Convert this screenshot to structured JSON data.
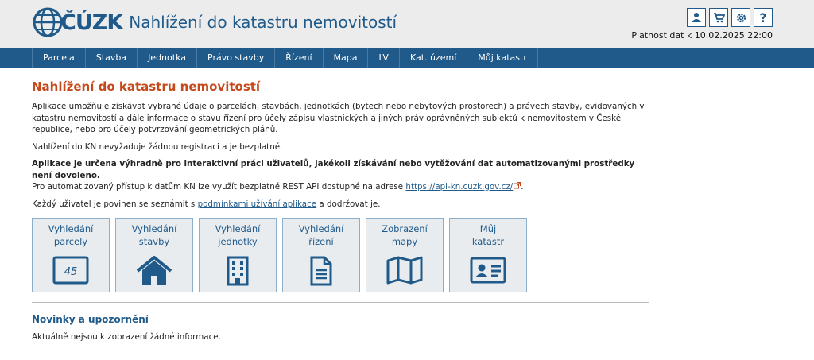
{
  "brand": {
    "logo_text": "ČÚZK",
    "app_title": "Nahlížení do katastru nemovitostí"
  },
  "header": {
    "validity": "Platnost dat k 10.02.2025 22:00"
  },
  "nav": [
    "Parcela",
    "Stavba",
    "Jednotka",
    "Právo stavby",
    "Řízení",
    "Mapa",
    "LV",
    "Kat. území",
    "Můj katastr"
  ],
  "main": {
    "title": "Nahlížení do katastru nemovitostí",
    "p1": "Aplikace umožňuje získávat vybrané údaje o parcelách, stavbách, jednotkách (bytech nebo nebytových prostorech) a právech stavby, evidovaných v katastru nemovitostí a dále informace o stavu řízení pro účely zápisu vlastnických a jiných práv oprávněných subjektů k nemovitostem v České republice, nebo pro účely potvrzování geometrických plánů.",
    "p2": "Nahlížení do KN nevyžaduje žádnou registraci a je bezplatné.",
    "p3_bold": "Aplikace je určena výhradně pro interaktivní práci uživatelů, jakékoli získávání nebo vytěžování dat automatizovanými prostředky není dovoleno.",
    "p3_text": "Pro automatizovaný přístup k datům KN lze využít bezplatné REST API dostupné na adrese ",
    "p3_link": "https://api-kn.cuzk.gov.cz/",
    "p4_text": "Každý uživatel je povinen se seznámit s ",
    "p4_link": "podmínkami užívání aplikace",
    "p4_after": " a dodržovat je."
  },
  "tiles": [
    {
      "label": "Vyhledání\nparcely",
      "icon": "parcel-icon",
      "icon_text": "45"
    },
    {
      "label": "Vyhledání\nstavby",
      "icon": "house-icon"
    },
    {
      "label": "Vyhledání\njednotky",
      "icon": "building-icon"
    },
    {
      "label": "Vyhledání\nřízení",
      "icon": "document-icon"
    },
    {
      "label": "Zobrazení\nmapy",
      "icon": "map-icon"
    },
    {
      "label": "Můj\nkatastr",
      "icon": "id-card-icon"
    }
  ],
  "news": {
    "title": "Novinky a upozornění",
    "text": "Aktuálně nejsou k zobrazení žádné informace."
  },
  "colors": {
    "brand": "#1f5a8a",
    "accent": "#c5491a"
  }
}
